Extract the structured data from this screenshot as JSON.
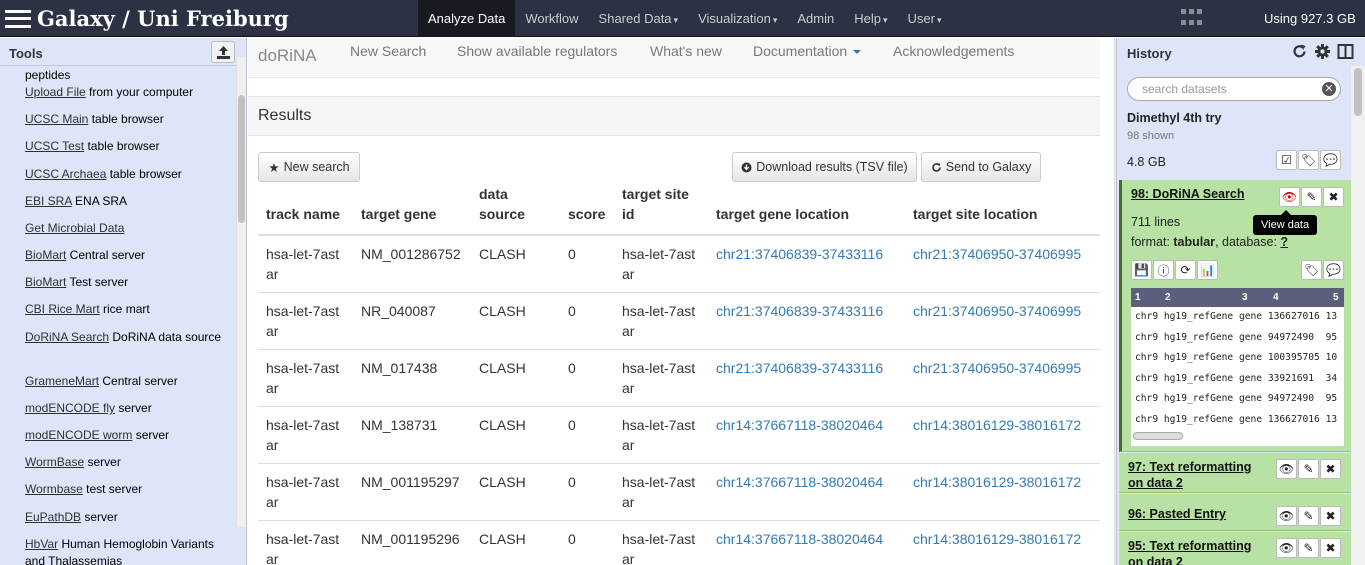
{
  "masthead": {
    "brand": "Galaxy / Uni Freiburg",
    "nav": [
      {
        "label": "Analyze Data",
        "active": true,
        "caret": false
      },
      {
        "label": "Workflow",
        "active": false,
        "caret": false
      },
      {
        "label": "Shared Data",
        "active": false,
        "caret": true
      },
      {
        "label": "Visualization",
        "active": false,
        "caret": true
      },
      {
        "label": "Admin",
        "active": false,
        "caret": false
      },
      {
        "label": "Help",
        "active": false,
        "caret": true
      },
      {
        "label": "User",
        "active": false,
        "caret": true
      }
    ],
    "quota": "Using 927.3 GB"
  },
  "tool_panel": {
    "title": "Tools",
    "items": [
      {
        "link": "",
        "rest": "peptides"
      },
      {
        "link": "Upload File",
        "rest": " from your computer"
      },
      {
        "link": "UCSC Main",
        "rest": " table browser"
      },
      {
        "link": "UCSC Test",
        "rest": " table browser"
      },
      {
        "link": "UCSC Archaea",
        "rest": " table browser"
      },
      {
        "link": "EBI SRA",
        "rest": " ENA SRA"
      },
      {
        "link": "Get Microbial Data",
        "rest": ""
      },
      {
        "link": "BioMart",
        "rest": " Central server"
      },
      {
        "link": "BioMart",
        "rest": " Test server"
      },
      {
        "link": "CBI Rice Mart",
        "rest": " rice mart"
      },
      {
        "link": "DoRiNA Search",
        "rest": " DoRiNA data source"
      },
      {
        "link": "GrameneMart",
        "rest": " Central server"
      },
      {
        "link": "modENCODE fly",
        "rest": " server"
      },
      {
        "link": "modENCODE worm",
        "rest": " server"
      },
      {
        "link": "WormBase",
        "rest": " server"
      },
      {
        "link": "Wormbase",
        "rest": " test server"
      },
      {
        "link": "EuPathDB",
        "rest": " server"
      },
      {
        "link": "HbVar",
        "rest": " Human Hemoglobin Variants and Thalassemias"
      }
    ]
  },
  "dorina": {
    "nav": {
      "brand": "doRiNA",
      "new_search": "New Search",
      "regulators": "Show available regulators",
      "whats_new": "What's new",
      "documentation": "Documentation",
      "acknowledgements": "Acknowledgements"
    },
    "results_title": "Results",
    "buttons": {
      "new_search": "New search",
      "download": "Download results (TSV file)",
      "send": "Send to Galaxy"
    },
    "table": {
      "columns": [
        "track name",
        "target gene",
        "data source",
        "score",
        "target site id",
        "target gene location",
        "target site location"
      ],
      "rows": [
        [
          "hsa-let-7astar",
          "NM_001286752",
          "CLASH",
          "0",
          "hsa-let-7astar",
          "chr21:37406839-37433116",
          "chr21:37406950-37406995"
        ],
        [
          "hsa-let-7astar",
          "NR_040087",
          "CLASH",
          "0",
          "hsa-let-7astar",
          "chr21:37406839-37433116",
          "chr21:37406950-37406995"
        ],
        [
          "hsa-let-7astar",
          "NM_017438",
          "CLASH",
          "0",
          "hsa-let-7astar",
          "chr21:37406839-37433116",
          "chr21:37406950-37406995"
        ],
        [
          "hsa-let-7astar",
          "NM_138731",
          "CLASH",
          "0",
          "hsa-let-7astar",
          "chr14:37667118-38020464",
          "chr14:38016129-38016172"
        ],
        [
          "hsa-let-7astar",
          "NM_001195297",
          "CLASH",
          "0",
          "hsa-let-7astar",
          "chr14:37667118-38020464",
          "chr14:38016129-38016172"
        ],
        [
          "hsa-let-7astar",
          "NM_001195296",
          "CLASH",
          "0",
          "hsa-let-7astar",
          "chr14:37667118-38020464",
          "chr14:38016129-38016172"
        ]
      ]
    }
  },
  "history": {
    "title": "History",
    "search_placeholder": "search datasets",
    "name": "Dimethyl 4th try",
    "shown": "98 shown",
    "size": "4.8 GB",
    "datasets": [
      {
        "title": "98: DoRiNA Search",
        "lines": "711 lines",
        "format_label": "format: ",
        "format": "tabular",
        "database_label": ", database: ",
        "database": "?",
        "peek_header": [
          "1",
          "2",
          "3",
          "4",
          "5"
        ],
        "peek_rows": [
          "chr9 hg19_refGene gene 136627016 13",
          "chr9 hg19_refGene gene 94972490  95",
          "chr9 hg19_refGene gene 100395705 10",
          "chr9 hg19_refGene gene 33921691  34",
          "chr9 hg19_refGene gene 94972490  95",
          "chr9 hg19_refGene gene 136627016 13"
        ]
      },
      {
        "title": "97: Text reformatting on data 2"
      },
      {
        "title": "96: Pasted Entry"
      },
      {
        "title": "95: Text reformatting on data 2"
      }
    ],
    "tooltip": "View data"
  },
  "colors": {
    "masthead": "#2c3143",
    "panel": "#dfe5f9",
    "dataset_ok": "#b8e2a3",
    "link": "#337ab7"
  }
}
